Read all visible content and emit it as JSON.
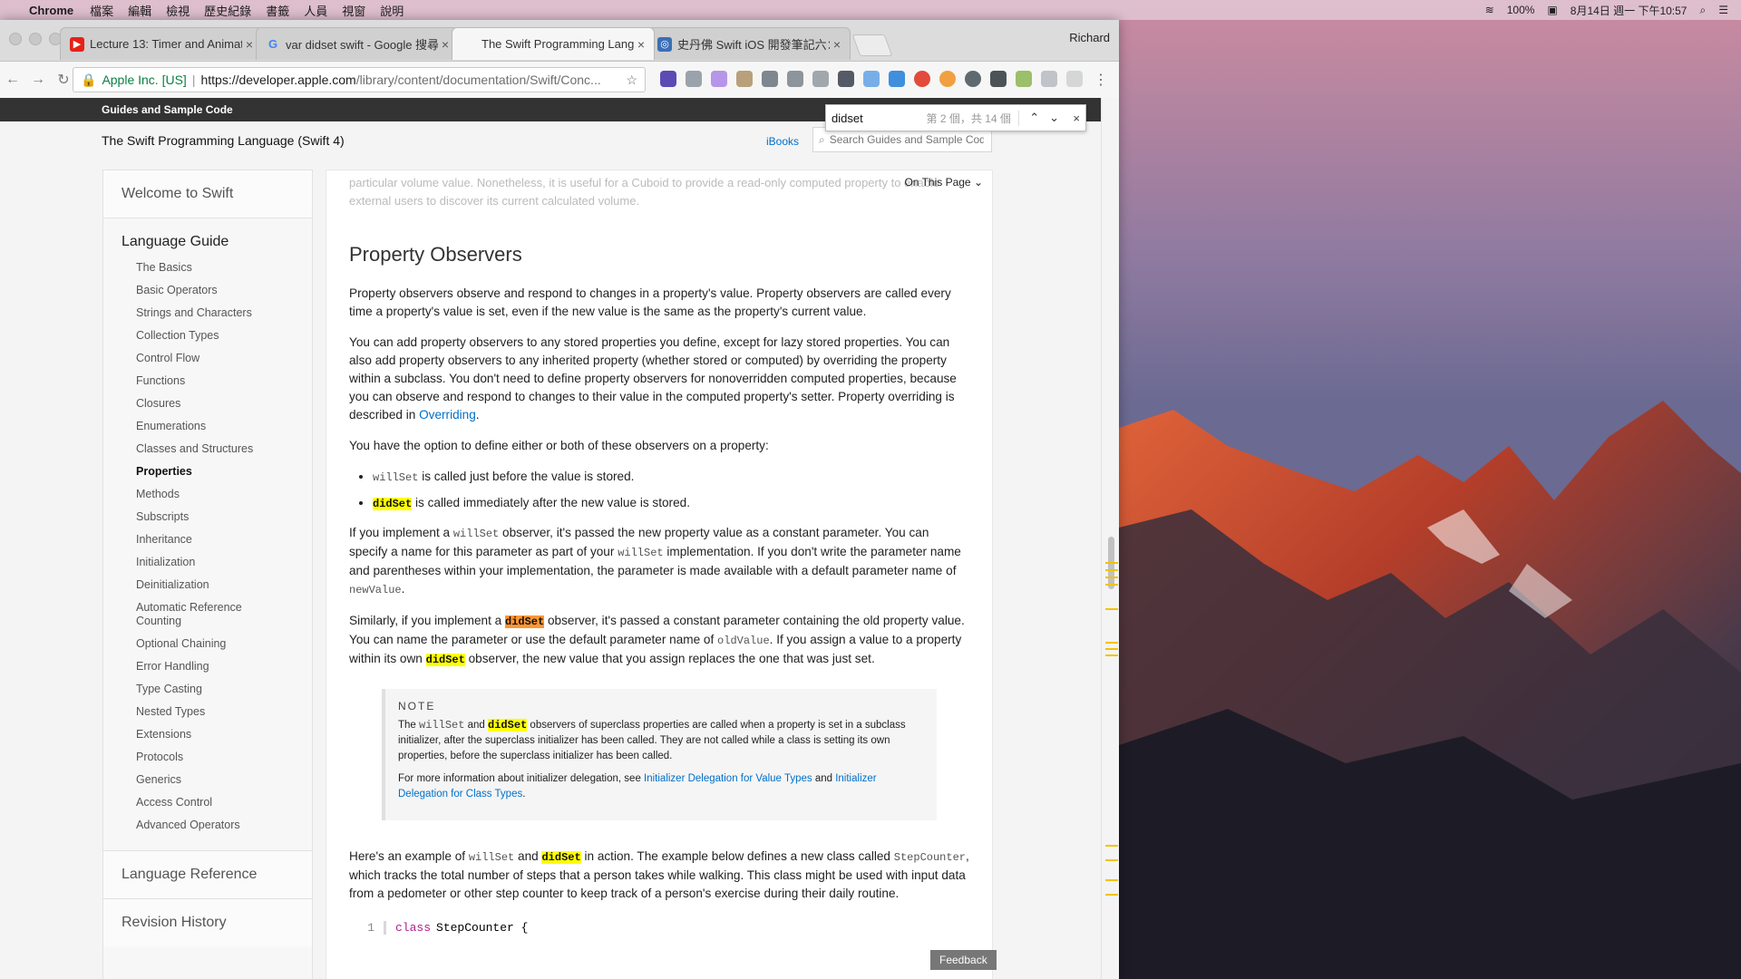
{
  "menubar": {
    "apple": "",
    "app_name": "Chrome",
    "items": [
      "檔案",
      "編輯",
      "檢視",
      "歷史紀錄",
      "書籤",
      "人員",
      "視窗",
      "說明"
    ],
    "battery": "100%",
    "datetime": "8月14日 週一 下午10:57"
  },
  "tabs": [
    {
      "title": "Lecture 13: Timer and Animati",
      "icon": "youtube-icon",
      "color": "#e62117"
    },
    {
      "title": "var didset swift - Google 搜尋",
      "icon": "google-icon",
      "color": "#4285f4"
    },
    {
      "title": "The Swift Programming Langu",
      "icon": "apple-icon",
      "color": "#555555"
    },
    {
      "title": "史丹佛 Swift iOS 開發筆記六：",
      "icon": "blog-icon",
      "color": "#3b6fb6"
    }
  ],
  "profile_name": "Richard",
  "omnibox": {
    "org": "Apple Inc. [US]",
    "url_host": "https://developer.apple.com",
    "url_path": "/library/content/documentation/Swift/Conc..."
  },
  "find_bar": {
    "query": "didset",
    "count": "第 2 個，共 14 個"
  },
  "page": {
    "topbar": "Guides and Sample Code",
    "doc_title": "The Swift Programming Language (Swift 4)",
    "ibooks": "iBooks",
    "search_placeholder": "Search Guides and Sample Code",
    "on_this_page": "On This Page",
    "feedback": "Feedback"
  },
  "sidebar": {
    "welcome": "Welcome to Swift",
    "guide": "Language Guide",
    "items": [
      "The Basics",
      "Basic Operators",
      "Strings and Characters",
      "Collection Types",
      "Control Flow",
      "Functions",
      "Closures",
      "Enumerations",
      "Classes and Structures",
      "Properties",
      "Methods",
      "Subscripts",
      "Inheritance",
      "Initialization",
      "Deinitialization",
      "Automatic Reference Counting",
      "Optional Chaining",
      "Error Handling",
      "Type Casting",
      "Nested Types",
      "Extensions",
      "Protocols",
      "Generics",
      "Access Control",
      "Advanced Operators"
    ],
    "active": "Properties",
    "reference": "Language Reference",
    "history": "Revision History"
  },
  "content": {
    "faded": "particular volume value. Nonetheless, it is useful for a Cuboid to provide a read-only computed property to enable external users to discover its current calculated volume.",
    "heading": "Property Observers",
    "p1": "Property observers observe and respond to changes in a property's value. Property observers are called every time a property's value is set, even if the new value is the same as the property's current value.",
    "p2": "You can add property observers to any stored properties you define, except for lazy stored properties. You can also add property observers to any inherited property (whether stored or computed) by overriding the property within a subclass. You don't need to define property observers for nonoverridden computed properties, because you can observe and respond to changes to their value in the computed property's setter. Property overriding is described in ",
    "p2_link": "Overriding",
    "p3": "You have the option to define either or both of these observers on a property:",
    "willset": "willSet",
    "didset": "didSet",
    "b1": " is called just before the value is stored.",
    "b2": " is called immediately after the new value is stored.",
    "p4a": "If you implement a ",
    "p4b": " observer, it's passed the new property value as a constant parameter. You can specify a name for this parameter as part of your ",
    "p4c": " implementation. If you don't write the parameter name and parentheses within your implementation, the parameter is made available with a default parameter name of ",
    "newvalue": "newValue",
    "p5a": "Similarly, if you implement a ",
    "p5b": " observer, it's passed a constant parameter containing the old property value. You can name the parameter or use the default parameter name of ",
    "oldvalue": "oldValue",
    "p5c": ". If you assign a value to a property within its own ",
    "p5d": " observer, the new value that you assign replaces the one that was just set.",
    "note_head": "NOTE",
    "note1a": "The ",
    "note1b": " and ",
    "note1c": " observers of superclass properties are called when a property is set in a subclass initializer, after the superclass initializer has been called. They are not called while a class is setting its own properties, before the superclass initializer has been called.",
    "note2a": "For more information about initializer delegation, see ",
    "note2_link1": "Initializer Delegation for Value Types",
    "note2b": " and ",
    "note2_link2": "Initializer Delegation for Class Types",
    "p6a": "Here's an example of ",
    "p6b": " and ",
    "p6c": " in action. The example below defines a new class called ",
    "stepcounter": "StepCounter",
    "p6d": ", which tracks the total number of steps that a person takes while walking. This class might be used with input data from a pedometer or other step counter to keep track of a person's exercise during their daily routine.",
    "code_ln": "1",
    "code_kw": "class",
    "code_rest": "StepCounter {"
  }
}
